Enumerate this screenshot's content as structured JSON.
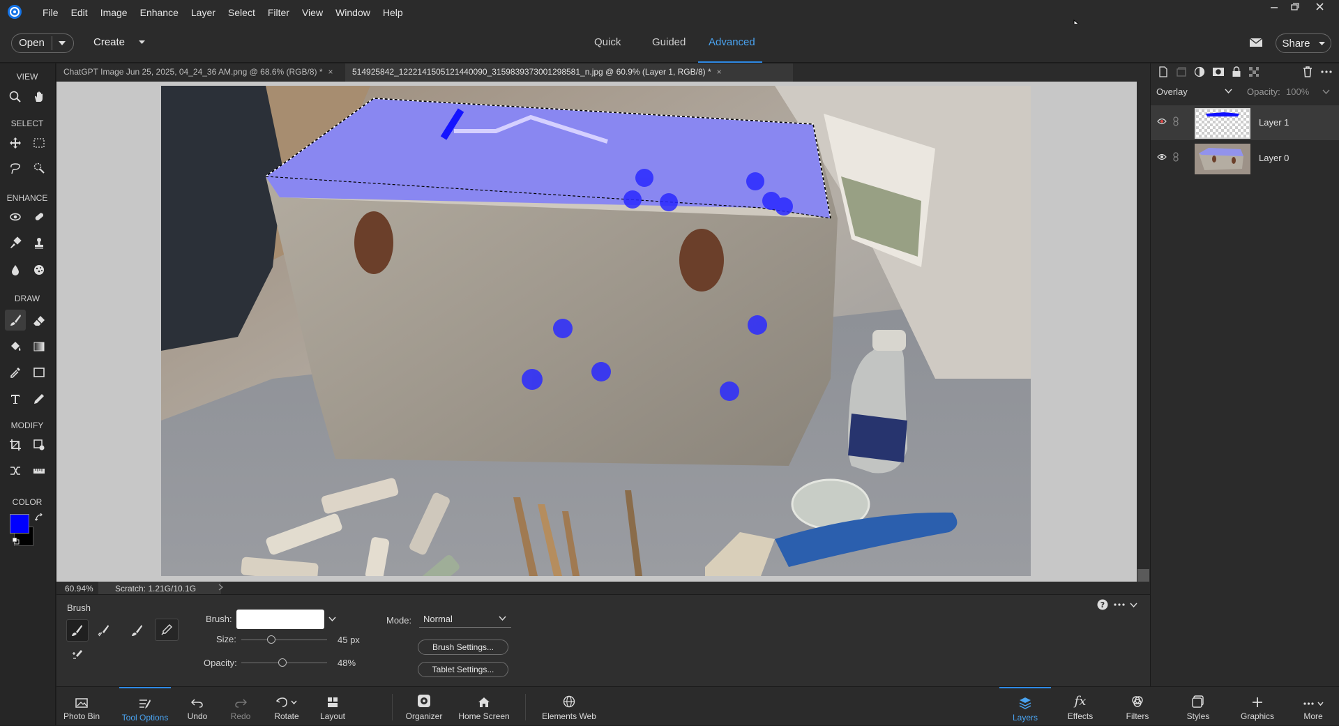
{
  "menu": [
    "File",
    "Edit",
    "Image",
    "Enhance",
    "Layer",
    "Select",
    "Filter",
    "View",
    "Window",
    "Help"
  ],
  "topbar": {
    "open_label": "Open",
    "create_label": "Create",
    "modes": [
      "Quick",
      "Guided",
      "Advanced"
    ],
    "active_mode": "Advanced",
    "share_label": "Share"
  },
  "toolbox": {
    "sections": [
      "VIEW",
      "SELECT",
      "ENHANCE",
      "DRAW",
      "MODIFY",
      "COLOR"
    ],
    "foreground_color": "#0000ff",
    "background_color": "#000000"
  },
  "tabs": [
    {
      "title": "ChatGPT Image Jun 25, 2025, 04_24_36 AM.png @ 68.6% (RGB/8) *",
      "close": "×"
    },
    {
      "title": "514925842_1222141505121440090_3159839373001298581_n.jpg @ 60.9% (Layer 1, RGB/8) *",
      "close": "×"
    }
  ],
  "status": {
    "zoom": "60.94%",
    "scratch": "Scratch: 1.21G/10.1G"
  },
  "tool_options": {
    "tool_name": "Brush",
    "brush_label": "Brush:",
    "size_label": "Size:",
    "size_value": "45 px",
    "size_fraction": 0.35,
    "opacity_label": "Opacity:",
    "opacity_value": "48%",
    "opacity_fraction": 0.48,
    "mode_label": "Mode:",
    "mode_value": "Normal",
    "brush_settings": "Brush Settings...",
    "tablet_settings": "Tablet Settings..."
  },
  "bottombar": {
    "left": [
      "Photo Bin",
      "Tool Options",
      "Undo",
      "Redo",
      "Rotate",
      "Layout",
      "Organizer",
      "Home Screen",
      "Elements Web"
    ],
    "right": [
      "Layers",
      "Effects",
      "Filters",
      "Styles",
      "Graphics",
      "More"
    ],
    "active_left": "Tool Options",
    "active_right": "Layers"
  },
  "layers_panel": {
    "blend_mode": "Overlay",
    "opacity_label": "Opacity:",
    "opacity_value": "100%",
    "layers": [
      "Layer 1",
      "Layer 0"
    ]
  }
}
